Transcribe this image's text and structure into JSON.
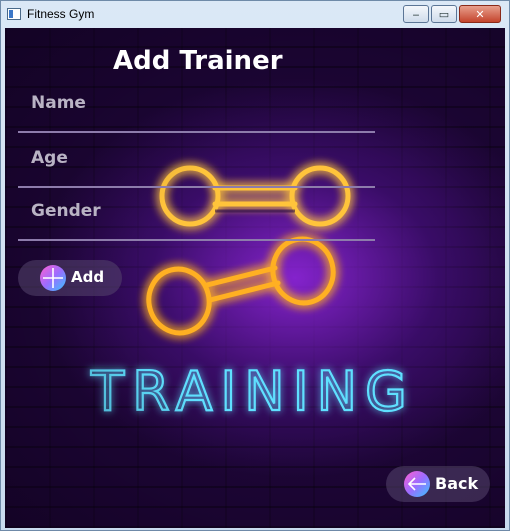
{
  "window": {
    "title": "Fitness Gym",
    "buttons": {
      "minimize": "‒",
      "maximize": "▭",
      "close": "✕"
    }
  },
  "form": {
    "heading": "Add Trainer",
    "fields": [
      {
        "label": "Name",
        "value": ""
      },
      {
        "label": "Age",
        "value": ""
      },
      {
        "label": "Gender",
        "value": ""
      }
    ],
    "add_label": "Add",
    "add_icon": "plus-icon",
    "back_label": "Back",
    "back_icon": "arrow-left-icon"
  },
  "artwork": {
    "neon_text": "TRAINING",
    "neon_icon": "dumbbell-icon",
    "colors": {
      "background": "#1e0638",
      "glow_purple": "#9628e6",
      "neon_orange": "#ffb020",
      "neon_blue": "#3fd0ff"
    }
  }
}
